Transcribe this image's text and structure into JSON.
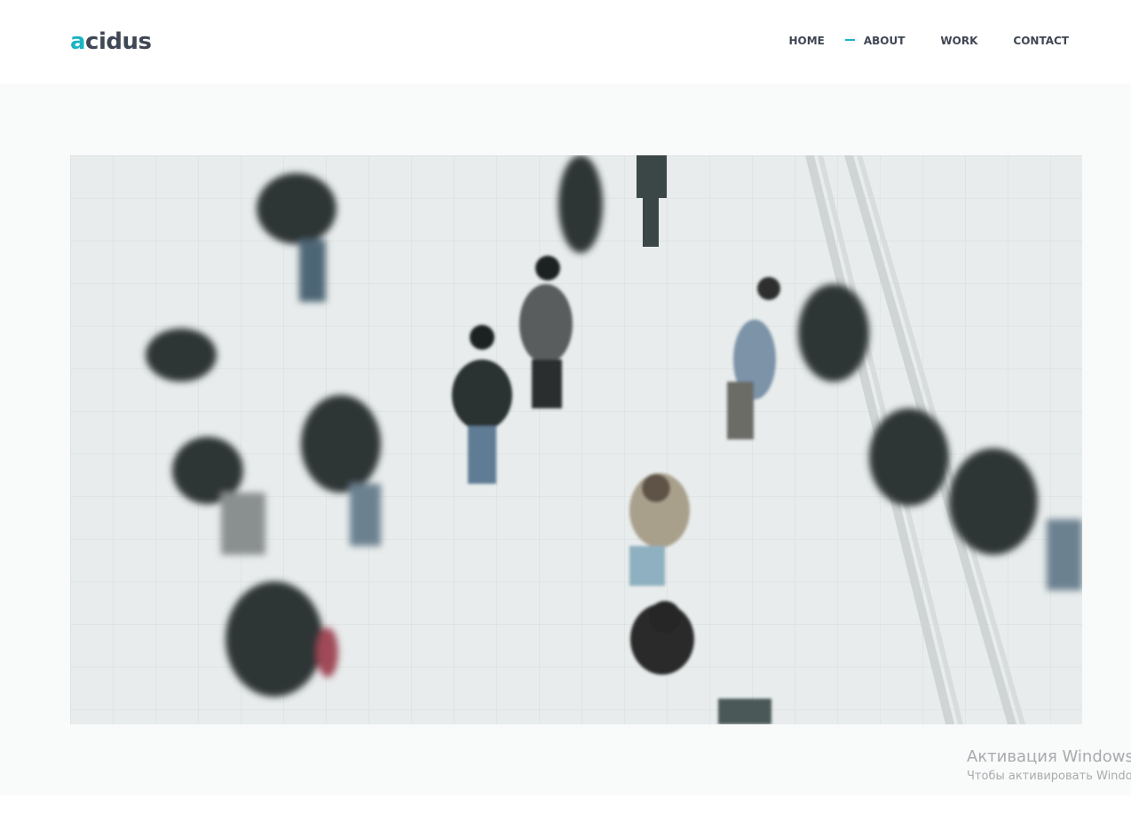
{
  "brand": {
    "logo_accent": "a",
    "logo_rest": "cidus",
    "accent_color": "#19b5c4",
    "text_color": "#3f4654"
  },
  "nav": {
    "items": [
      {
        "label": "HOME",
        "active": false
      },
      {
        "label": "ABOUT",
        "active": true
      },
      {
        "label": "WORK",
        "active": false
      },
      {
        "label": "CONTACT",
        "active": false
      }
    ]
  },
  "hero": {
    "image_subject": "overhead photo of pedestrians walking across a tiled plaza"
  },
  "os_watermark": {
    "title": "Активация Windows",
    "subtitle": "Чтобы активировать Windows"
  }
}
